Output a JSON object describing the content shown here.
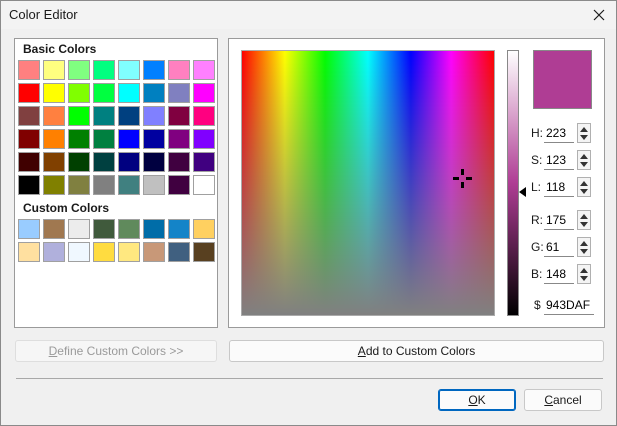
{
  "window": {
    "title": "Color Editor"
  },
  "basic_colors": {
    "label": "Basic Colors",
    "swatches": [
      "#ff8080",
      "#ffff80",
      "#80ff80",
      "#00ff80",
      "#80ffff",
      "#0080ff",
      "#ff80c0",
      "#ff80ff",
      "#ff0000",
      "#ffff00",
      "#80ff00",
      "#00ff40",
      "#00ffff",
      "#0080c0",
      "#8080c0",
      "#ff00ff",
      "#804040",
      "#ff8040",
      "#00ff00",
      "#008080",
      "#004080",
      "#8080ff",
      "#800040",
      "#ff0080",
      "#800000",
      "#ff8000",
      "#008000",
      "#008040",
      "#0000ff",
      "#0000a0",
      "#800080",
      "#8000ff",
      "#400000",
      "#804000",
      "#004000",
      "#004040",
      "#000080",
      "#000040",
      "#400040",
      "#400080",
      "#000000",
      "#808000",
      "#808040",
      "#808080",
      "#408080",
      "#c0c0c0",
      "#400040",
      "#ffffff"
    ]
  },
  "custom_colors": {
    "label": "Custom Colors",
    "swatches": [
      "#99ccff",
      "#a07850",
      "#ececec",
      "#405a3c",
      "#608a5c",
      "#006da8",
      "#1484c8",
      "#ffd060",
      "#ffe0a0",
      "#b0b0dc",
      "#f0f8ff",
      "#ffdc40",
      "#ffe880",
      "#c89878",
      "#406080",
      "#584020"
    ]
  },
  "editor": {
    "current_color": "#af3d94",
    "crosshair": {
      "hue_fraction": 0.873,
      "saturation_fraction": 0.518
    },
    "luminance_fraction": 0.463,
    "fields": [
      {
        "label": "H:",
        "value": "223"
      },
      {
        "label": "S:",
        "value": "123"
      },
      {
        "label": "L:",
        "value": "118"
      },
      {
        "label": "R:",
        "value": "175"
      },
      {
        "label": "G:",
        "value": "61"
      },
      {
        "label": "B:",
        "value": "148"
      }
    ],
    "hex": {
      "label": "$",
      "value": "943DAF"
    }
  },
  "buttons": {
    "define_custom": {
      "pre": "",
      "key": "D",
      "post": "efine Custom Colors >>"
    },
    "add_custom": {
      "pre": "",
      "key": "A",
      "post": "dd to Custom Colors"
    },
    "ok": {
      "pre": "",
      "key": "O",
      "post": "K"
    },
    "cancel": {
      "pre": "",
      "key": "C",
      "post": "ancel"
    }
  }
}
